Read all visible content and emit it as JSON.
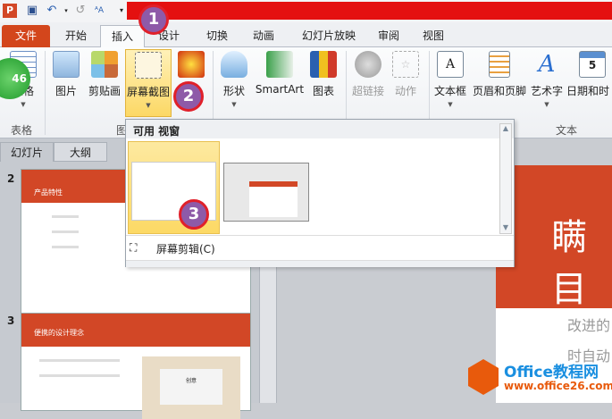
{
  "qat": {
    "icons": [
      "powerpoint-app-icon",
      "save-icon",
      "undo-icon",
      "redo-icon",
      "text-size-icon",
      "customize-qat-icon"
    ]
  },
  "tabs": [
    "文件",
    "开始",
    "插入",
    "设计",
    "切换",
    "动画",
    "幻灯片放映",
    "审阅",
    "视图"
  ],
  "active_tab": "插入",
  "ribbon": {
    "buttons": {
      "table": "表格",
      "picture": "图片",
      "clipart": "剪贴画",
      "screenshot": "屏幕截图",
      "shapes": "形状",
      "smartart": "SmartArt",
      "chart": "图表",
      "hyperlink": "超链接",
      "action": "动作",
      "textbox": "文本框",
      "header_footer": "页眉和页脚",
      "wordart": "艺术字",
      "datetime": "日期和时"
    },
    "groups": {
      "tables": "表格",
      "images": "图",
      "text": "文本"
    },
    "badge": "46"
  },
  "dropdown": {
    "header": "可用 视窗",
    "clip_label": "屏幕剪辑(C)"
  },
  "left_pane": {
    "tabs": [
      "幻灯片",
      "大纲"
    ],
    "slides": [
      {
        "number": "2",
        "title": "产品特性"
      },
      {
        "number": "3",
        "title": "便携的设计理念",
        "card": "创意"
      }
    ]
  },
  "main_slide": {
    "title": "瞒目",
    "lines": [
      "改进的",
      "时自动"
    ]
  },
  "markers": [
    "1",
    "2",
    "3"
  ],
  "watermark": {
    "brand": "Office教程网",
    "url": "www.office26.com"
  },
  "colors": {
    "accent": "#d24726",
    "marker": "#8e5aa8",
    "highlight": "#fde58a"
  }
}
